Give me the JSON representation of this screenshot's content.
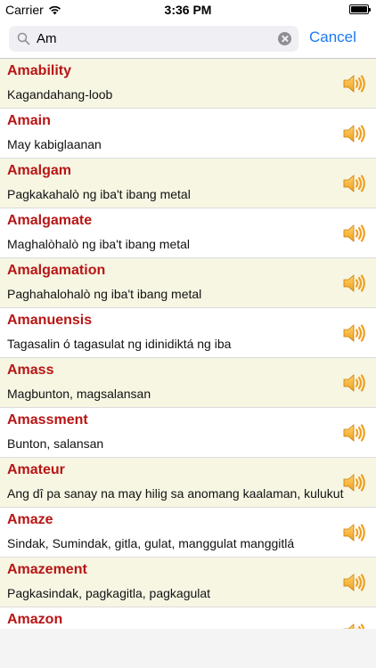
{
  "status": {
    "carrier": "Carrier",
    "time": "3:36 PM",
    "battery_level": 1.0
  },
  "search": {
    "query": "Am",
    "cancel_label": "Cancel"
  },
  "entries": [
    {
      "word": "Amability",
      "meaning": "Kagandahang-loob"
    },
    {
      "word": "Amain",
      "meaning": "May kabiglaanan"
    },
    {
      "word": "Amalgam",
      "meaning": "Pagkakahalò ng iba't ibang metal"
    },
    {
      "word": "Amalgamate",
      "meaning": "Maghalòhalò ng iba't ibang metal"
    },
    {
      "word": "Amalgamation",
      "meaning": "Paghahalohalò ng iba't ibang metal"
    },
    {
      "word": "Amanuensis",
      "meaning": "Tagasalin ó tagasulat ng idinidiktá ng iba"
    },
    {
      "word": "Amass",
      "meaning": "Magbunton, magsalansan"
    },
    {
      "word": "Amassment",
      "meaning": "Bunton, salansan"
    },
    {
      "word": "Amateur",
      "meaning": "Ang dî pa sanay na may hilig sa anomang kaalaman, kulukut"
    },
    {
      "word": "Amaze",
      "meaning": "Sindak, Sumindak, gitla, gulat, manggulat manggitlá"
    },
    {
      "word": "Amazement",
      "meaning": "Pagkasindak, pagkagitla, pagkagulat"
    },
    {
      "word": "Amazon",
      "meaning": ""
    }
  ],
  "colors": {
    "word": "#b81515",
    "alt_row": "#f6f6e3",
    "accent": "#1a7af4"
  },
  "icons": {
    "row_action": "speaker-icon"
  }
}
